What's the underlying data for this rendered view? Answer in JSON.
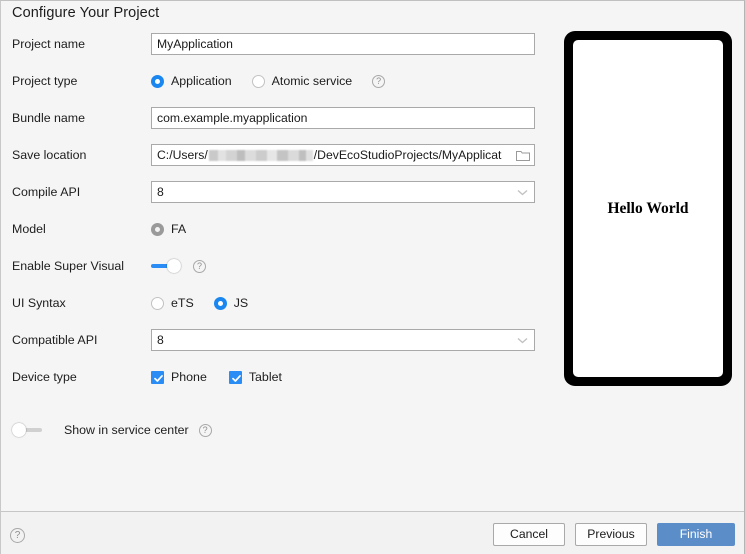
{
  "dialog": {
    "title": "Configure Your Project"
  },
  "form": {
    "project_name": {
      "label": "Project name",
      "value": "MyApplication",
      "placeholder": "Project name"
    },
    "project_type": {
      "label": "Project type",
      "options": [
        "Application",
        "Atomic service"
      ],
      "selected": "Application",
      "help_icon": "question-circle-icon",
      "help_glyph": "?"
    },
    "bundle_name": {
      "label": "Bundle name",
      "value": "com.example.myapplication",
      "placeholder": "Bundle name"
    },
    "save_location": {
      "label": "Save location",
      "prefix": "C:/Users/",
      "redacted": "",
      "suffix": "/DevEcoStudioProjects/MyApplicat",
      "browse_icon": "folder-icon"
    },
    "compile_api": {
      "label": "Compile API",
      "value": "8",
      "options": [
        "8"
      ],
      "chevron_icon": "chevron-down-icon"
    },
    "model": {
      "label": "Model",
      "options": [
        "FA"
      ],
      "selected": "FA"
    },
    "enable_super_visual": {
      "label": "Enable Super Visual",
      "state": "on",
      "help_icon": "question-circle-icon",
      "help_glyph": "?"
    },
    "ui_syntax": {
      "label": "UI Syntax",
      "options": [
        "eTS",
        "JS"
      ],
      "selected": "JS"
    },
    "compatible_api": {
      "label": "Compatible API",
      "value": "8",
      "options": [
        "8"
      ],
      "chevron_icon": "chevron-down-icon"
    },
    "device_type": {
      "label": "Device type",
      "options": [
        "Phone",
        "Tablet"
      ],
      "checked": [
        "Phone",
        "Tablet"
      ]
    },
    "show_in_service_center": {
      "label": "Show in service center",
      "state": "off",
      "help_icon": "question-circle-icon",
      "help_glyph": "?"
    }
  },
  "preview": {
    "text": "Hello World"
  },
  "footer": {
    "help_icon": "question-circle-icon",
    "help_glyph": "?",
    "cancel_label": "Cancel",
    "previous_label": "Previous",
    "finish_label": "Finish"
  },
  "colors": {
    "accent_blue": "#1a87f0",
    "checkbox_blue": "#2a8cf5",
    "primary_button": "#5b8ec9",
    "background": "#f5f5f5",
    "field_border": "#a9a9a9"
  }
}
